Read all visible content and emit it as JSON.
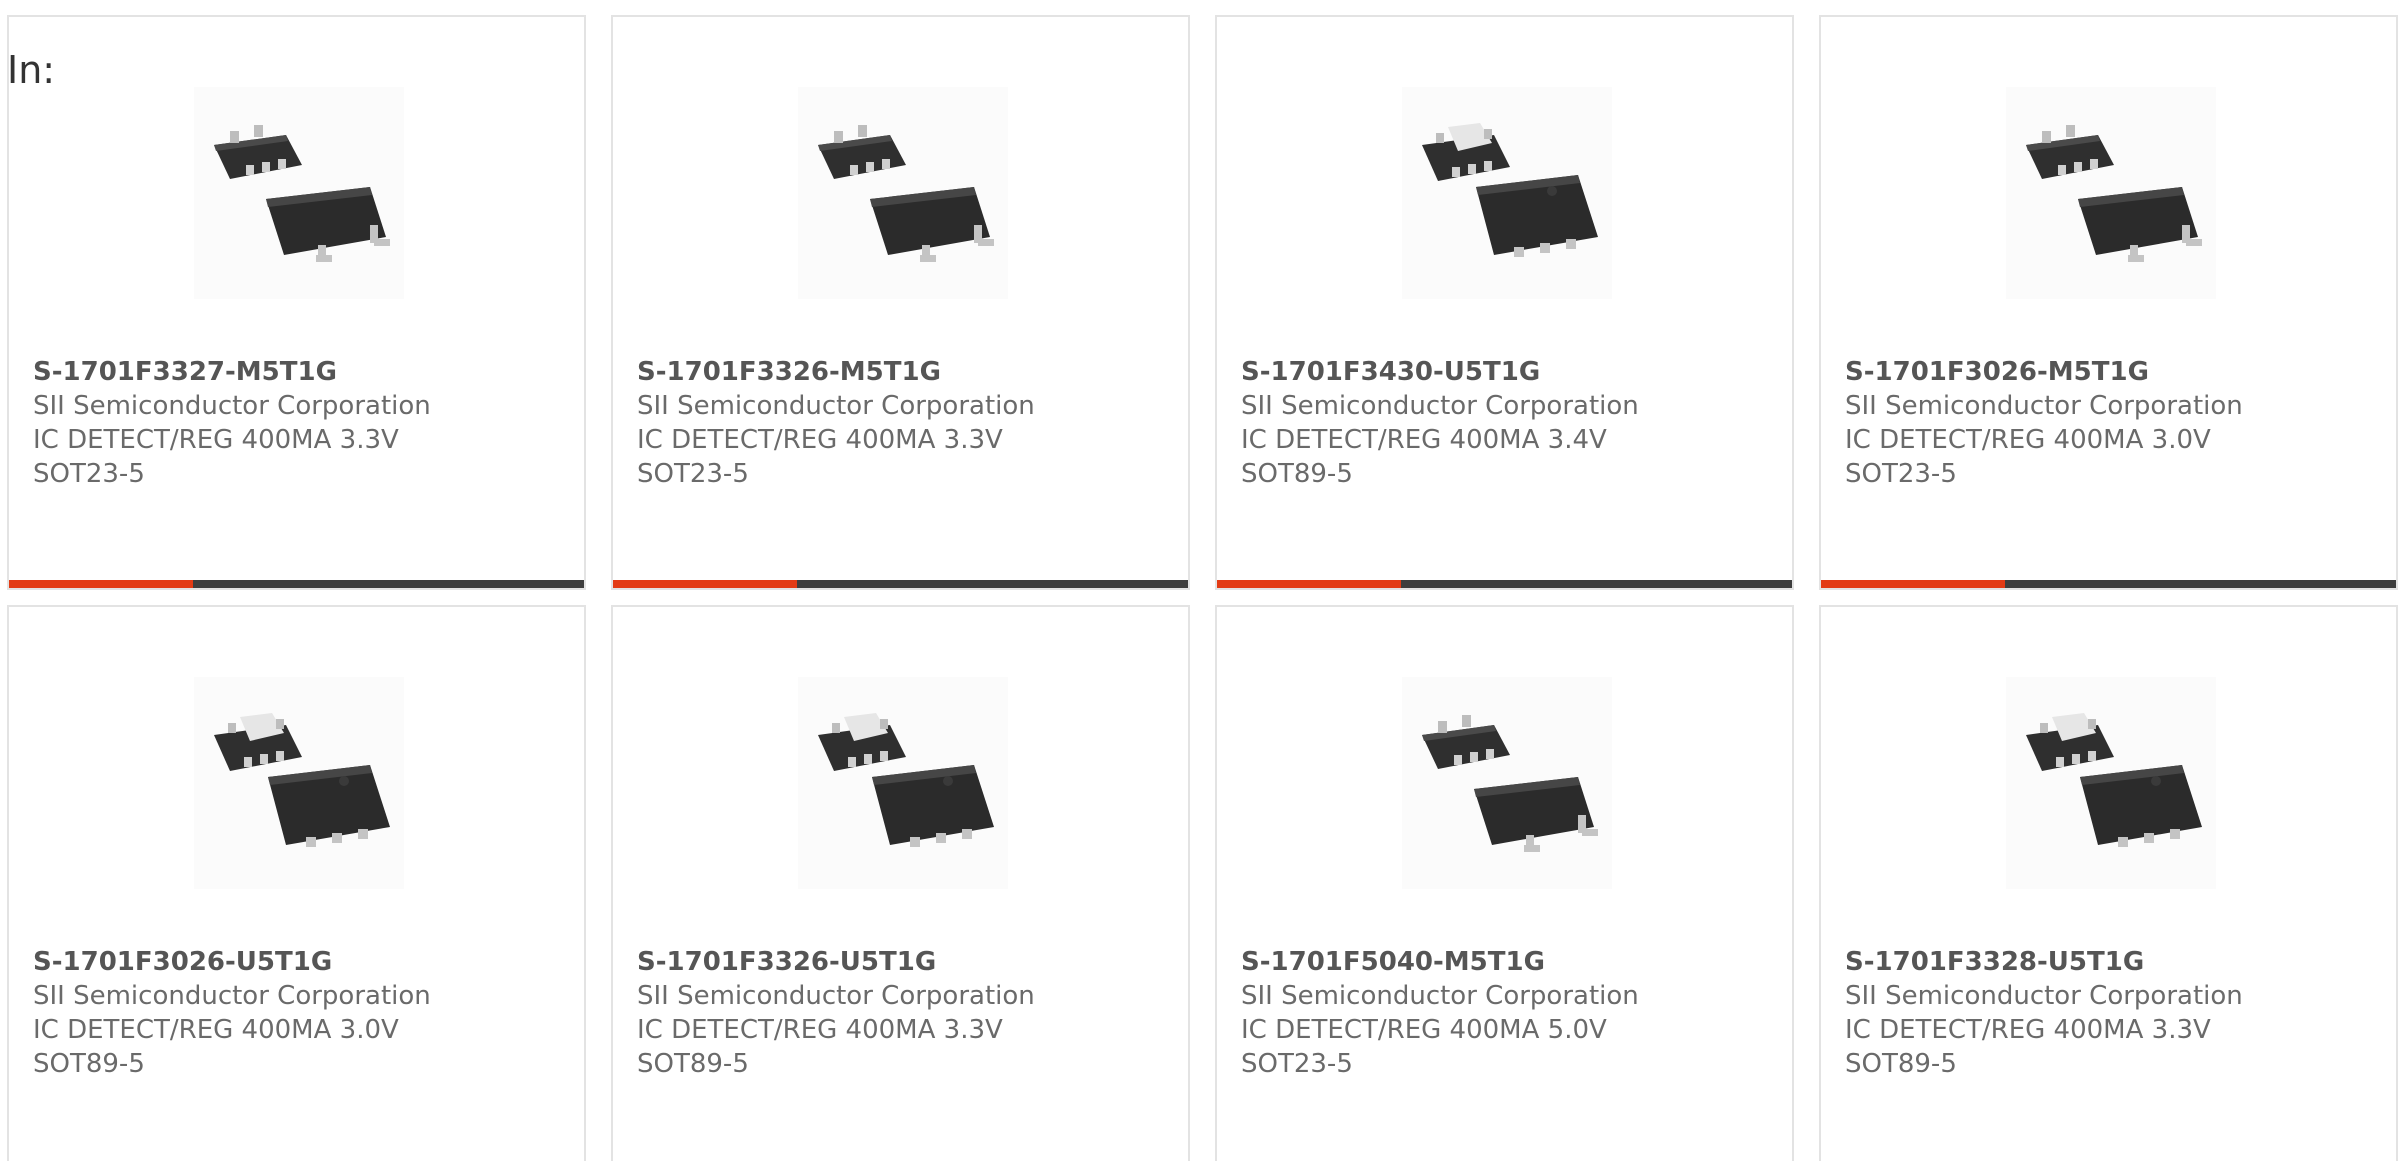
{
  "label_in": "In:",
  "products": [
    {
      "part_number": "S-1701F3327-M5T1G",
      "manufacturer": "SII Semiconductor Corporation",
      "description": "IC DETECT/REG 400MA 3.3V",
      "package": "SOT23-5",
      "image": "sot23-5-package-image",
      "progress": 0.32
    },
    {
      "part_number": "S-1701F3326-M5T1G",
      "manufacturer": "SII Semiconductor Corporation",
      "description": "IC DETECT/REG 400MA 3.3V",
      "package": "SOT23-5",
      "image": "sot23-5-package-image",
      "progress": 0.32
    },
    {
      "part_number": "S-1701F3430-U5T1G",
      "manufacturer": "SII Semiconductor Corporation",
      "description": "IC DETECT/REG 400MA 3.4V",
      "package": "SOT89-5",
      "image": "sot89-5-package-image",
      "progress": 0.32
    },
    {
      "part_number": "S-1701F3026-M5T1G",
      "manufacturer": "SII Semiconductor Corporation",
      "description": "IC DETECT/REG 400MA 3.0V",
      "package": "SOT23-5",
      "image": "sot23-5-package-image",
      "progress": 0.32
    },
    {
      "part_number": "S-1701F3026-U5T1G",
      "manufacturer": "SII Semiconductor Corporation",
      "description": "IC DETECT/REG 400MA 3.0V",
      "package": "SOT89-5",
      "image": "sot89-5-package-image"
    },
    {
      "part_number": "S-1701F3326-U5T1G",
      "manufacturer": "SII Semiconductor Corporation",
      "description": "IC DETECT/REG 400MA 3.3V",
      "package": "SOT89-5",
      "image": "sot89-5-package-image"
    },
    {
      "part_number": "S-1701F5040-M5T1G",
      "manufacturer": "SII Semiconductor Corporation",
      "description": "IC DETECT/REG 400MA 5.0V",
      "package": "SOT23-5",
      "image": "sot23-5-package-image"
    },
    {
      "part_number": "S-1701F3328-U5T1G",
      "manufacturer": "SII Semiconductor Corporation",
      "description": "IC DETECT/REG 400MA 3.3V",
      "package": "SOT89-5",
      "image": "sot89-5-package-image"
    }
  ],
  "colors": {
    "progress_fill": "#e33b15",
    "progress_track": "#3e3e3e",
    "card_border": "#e3e3e3",
    "text": "#6a6a6a"
  }
}
